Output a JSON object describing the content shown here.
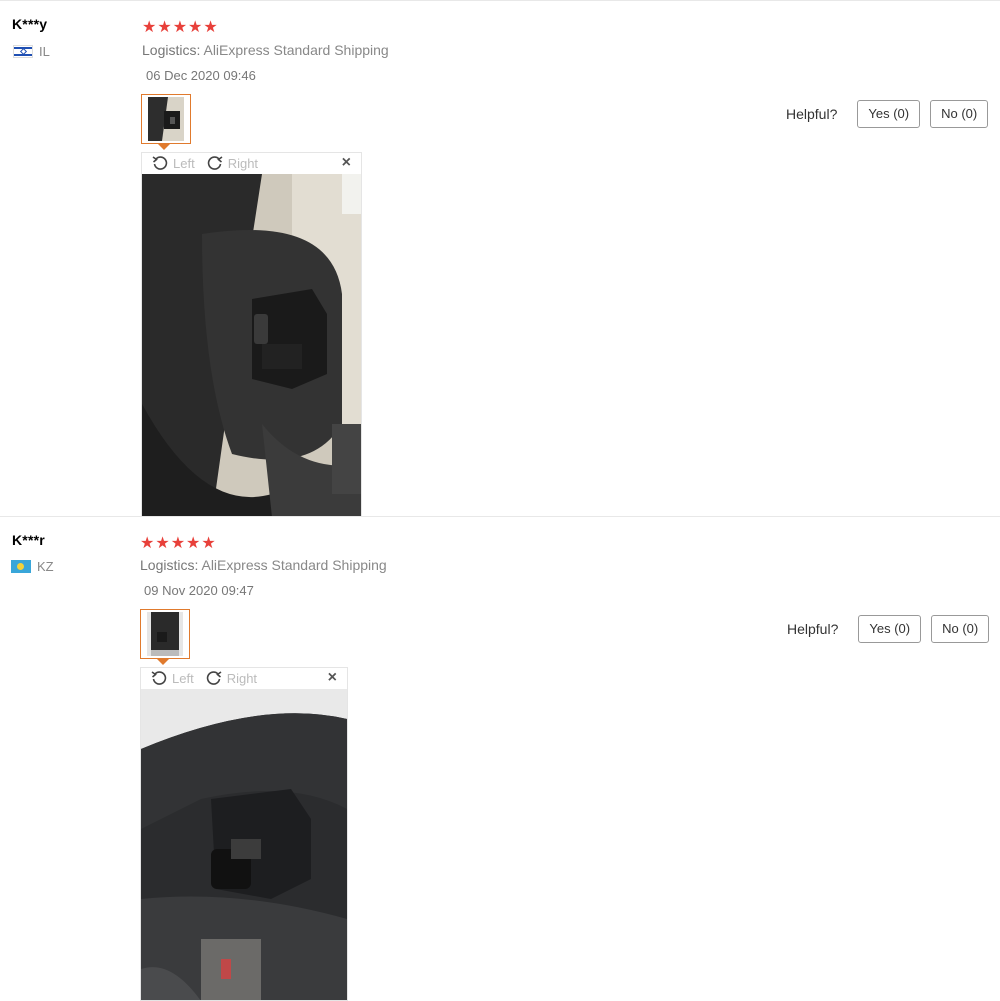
{
  "reviews": [
    {
      "user": "K***y",
      "country": "IL",
      "stars": "★★★★★",
      "logistics_label": "Logistics:",
      "logistics_value": "AliExpress Standard Shipping",
      "date": "06 Dec 2020 09:46",
      "helpful_label": "Helpful?",
      "yes_label": "Yes (0)",
      "no_label": "No (0)",
      "viewer": {
        "left_label": "Left",
        "right_label": "Right",
        "close_label": "×"
      }
    },
    {
      "user": "K***r",
      "country": "KZ",
      "stars": "★★★★★",
      "logistics_label": "Logistics:",
      "logistics_value": "AliExpress Standard Shipping",
      "date": "09 Nov 2020 09:47",
      "helpful_label": "Helpful?",
      "yes_label": "Yes (0)",
      "no_label": "No (0)",
      "viewer": {
        "left_label": "Left",
        "right_label": "Right",
        "close_label": "×"
      }
    }
  ],
  "colors": {
    "star": "#e8403a",
    "thumb_border": "#e07a2d"
  },
  "icons": [
    "rotate-left-icon",
    "rotate-right-icon",
    "close-icon",
    "flag-il-icon",
    "flag-kz-icon"
  ]
}
